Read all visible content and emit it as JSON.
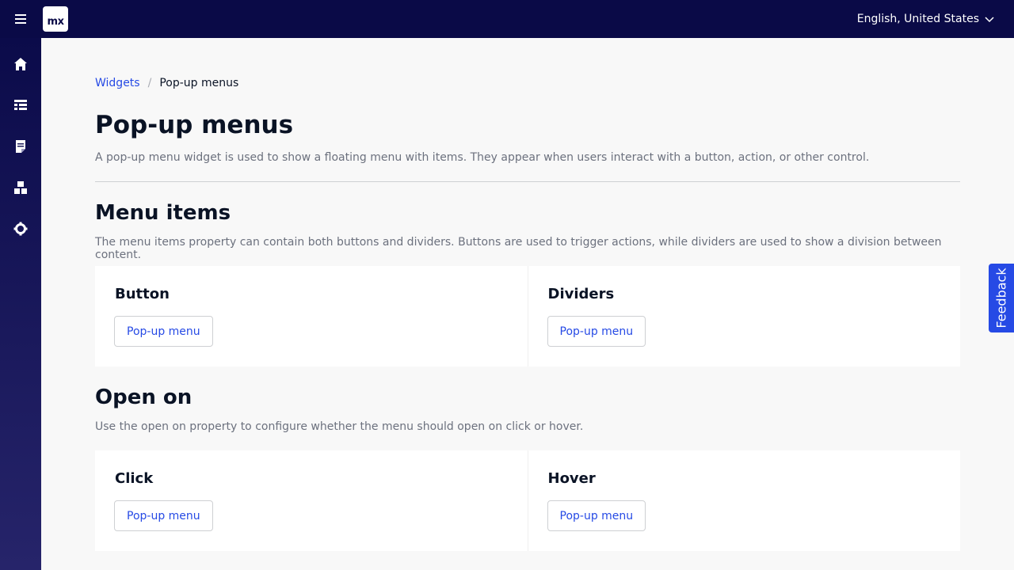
{
  "topbar": {
    "logo_text": "mx",
    "language": "English, United States",
    "menu_icon": "hamburger-icon",
    "language_icon": "chevron-down-icon"
  },
  "sidebar": {
    "items": [
      {
        "icon": "home-icon"
      },
      {
        "icon": "table-icon"
      },
      {
        "icon": "document-icon"
      },
      {
        "icon": "widgets-icon"
      },
      {
        "icon": "gear-icon"
      }
    ]
  },
  "breadcrumb": {
    "parent": "Widgets",
    "separator": "/",
    "current": "Pop-up menus"
  },
  "page": {
    "title": "Pop-up menus",
    "lead": "A pop-up menu widget is used to show a floating menu with items. They appear when users interact with a button, action, or other control."
  },
  "sections": [
    {
      "title": "Menu items",
      "description": "The menu items property can contain both buttons and dividers. Buttons are used to trigger actions, while dividers are used to show a division between content.",
      "cards": [
        {
          "title": "Button",
          "button": "Pop-up menu"
        },
        {
          "title": "Dividers",
          "button": "Pop-up menu"
        }
      ]
    },
    {
      "title": "Open on",
      "description": "Use the open on property to configure whether the menu should open on click or hover.",
      "cards": [
        {
          "title": "Click",
          "button": "Pop-up menu"
        },
        {
          "title": "Hover",
          "button": "Pop-up menu"
        }
      ]
    }
  ],
  "feedback": {
    "label": "Feedback"
  },
  "colors": {
    "topbar": "#0a0a47",
    "accent": "#264ae5",
    "text": "#0a1325",
    "muted": "#6c717e"
  }
}
